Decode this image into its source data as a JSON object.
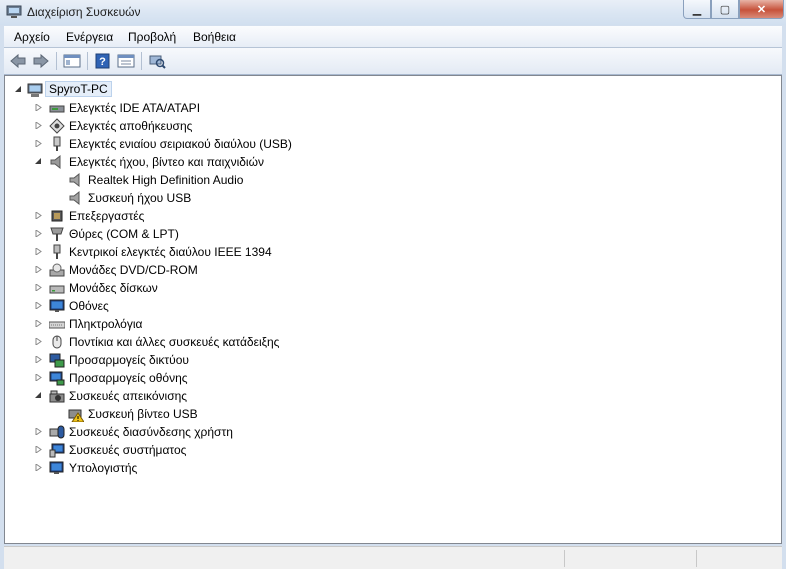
{
  "window": {
    "title": "Διαχείριση Συσκευών"
  },
  "menubar": {
    "items": [
      "Αρχείο",
      "Ενέργεια",
      "Προβολή",
      "Βοήθεια"
    ]
  },
  "tree": {
    "root": "SpyroT-PC",
    "nodes": [
      {
        "label": "Ελεγκτές IDE ATA/ATAPI",
        "icon": "ide-controller-icon",
        "expanded": false,
        "level": 1
      },
      {
        "label": "Ελεγκτές αποθήκευσης",
        "icon": "storage-controller-icon",
        "expanded": false,
        "level": 1
      },
      {
        "label": "Ελεγκτές ενιαίου σειριακού διαύλου (USB)",
        "icon": "usb-controller-icon",
        "expanded": false,
        "level": 1
      },
      {
        "label": "Ελεγκτές ήχου, βίντεο και παιχνιδιών",
        "icon": "sound-controller-icon",
        "expanded": true,
        "level": 1
      },
      {
        "label": "Realtek High Definition Audio",
        "icon": "speaker-icon",
        "level": 2
      },
      {
        "label": "Συσκευή ήχου USB",
        "icon": "speaker-icon",
        "level": 2
      },
      {
        "label": "Επεξεργαστές",
        "icon": "processor-icon",
        "expanded": false,
        "level": 1
      },
      {
        "label": "Θύρες (COM & LPT)",
        "icon": "port-icon",
        "expanded": false,
        "level": 1
      },
      {
        "label": "Κεντρικοί ελεγκτές διαύλου IEEE 1394",
        "icon": "ieee1394-icon",
        "expanded": false,
        "level": 1
      },
      {
        "label": "Μονάδες DVD/CD-ROM",
        "icon": "dvd-drive-icon",
        "expanded": false,
        "level": 1
      },
      {
        "label": "Μονάδες δίσκων",
        "icon": "disk-drive-icon",
        "expanded": false,
        "level": 1
      },
      {
        "label": "Οθόνες",
        "icon": "monitor-icon",
        "expanded": false,
        "level": 1
      },
      {
        "label": "Πληκτρολόγια",
        "icon": "keyboard-icon",
        "expanded": false,
        "level": 1
      },
      {
        "label": "Ποντίκια και άλλες συσκευές κατάδειξης",
        "icon": "mouse-icon",
        "expanded": false,
        "level": 1
      },
      {
        "label": "Προσαρμογείς δικτύου",
        "icon": "network-adapter-icon",
        "expanded": false,
        "level": 1
      },
      {
        "label": "Προσαρμογείς οθόνης",
        "icon": "display-adapter-icon",
        "expanded": false,
        "level": 1
      },
      {
        "label": "Συσκευές απεικόνισης",
        "icon": "imaging-device-icon",
        "expanded": true,
        "level": 1
      },
      {
        "label": "Συσκευή βίντεο USB",
        "icon": "warning-camera-icon",
        "level": 2
      },
      {
        "label": "Συσκευές διασύνδεσης χρήστη",
        "icon": "hid-icon",
        "expanded": false,
        "level": 1
      },
      {
        "label": "Συσκευές συστήματος",
        "icon": "system-device-icon",
        "expanded": false,
        "level": 1
      },
      {
        "label": "Υπολογιστής",
        "icon": "computer-icon",
        "expanded": false,
        "level": 1
      }
    ]
  },
  "colors": {
    "accent": "#1f5fbf",
    "title_bg": "#dbe6f3",
    "close": "#c7523b"
  }
}
